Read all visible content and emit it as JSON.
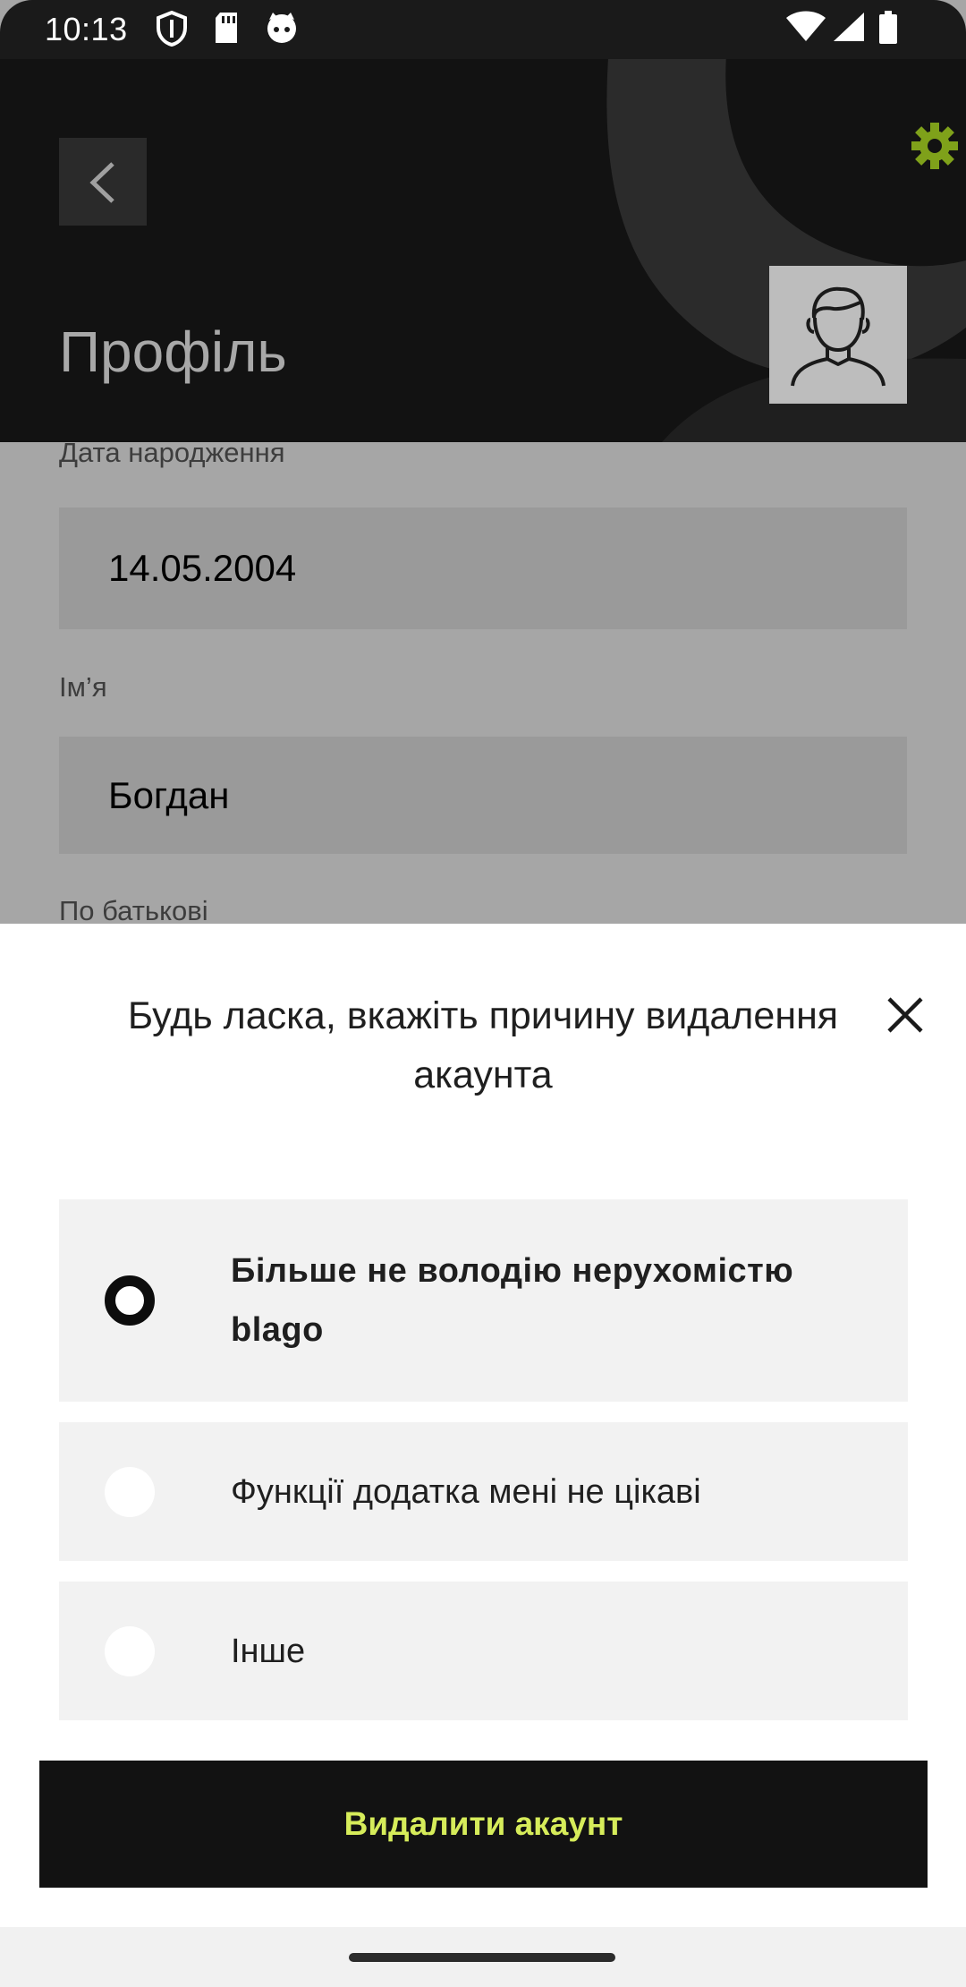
{
  "status_bar": {
    "time": "10:13"
  },
  "header": {
    "title": "Профіль",
    "back_icon": "chevron-left-icon",
    "settings_icon": "gear-icon",
    "settings_color": "#7fa11a",
    "avatar_icon": "user-avatar-icon"
  },
  "form": {
    "birth_date_label": "Дата народження",
    "birth_date_value": "14.05.2004",
    "first_name_label": "Ім’я",
    "first_name_value": "Богдан",
    "patronymic_label": "По батькові"
  },
  "sheet": {
    "title": "Будь ласка, вкажіть причину видалення акаунта",
    "close_icon": "close-icon",
    "options": [
      {
        "label": "Більше не володію нерухомістю blago",
        "selected": true
      },
      {
        "label": "Функції додатка мені не цікаві",
        "selected": false
      },
      {
        "label": "Інше",
        "selected": false
      }
    ],
    "delete_label": "Видалити акаунт",
    "delete_text_color": "#d6ec5a"
  }
}
